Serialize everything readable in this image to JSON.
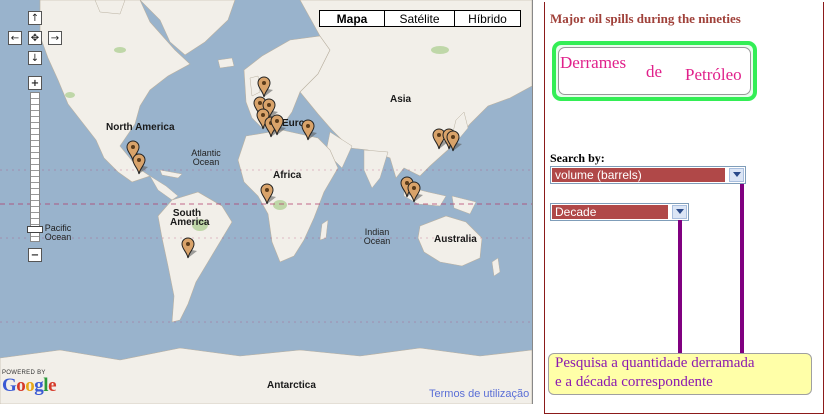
{
  "map": {
    "map_types": [
      "Mapa",
      "Satélite",
      "Híbrido"
    ],
    "active_map_type": "Mapa",
    "labels": {
      "north_america": "North America",
      "south_america": "South America",
      "atlantic": "Atlantic Ocean",
      "pacific": "Pacific Ocean",
      "indian": "Indian Ocean",
      "africa": "Africa",
      "europe": "Europ",
      "asia": "Asia",
      "australia": "Australia",
      "antarctica": "Antarctica"
    },
    "powered_by": "POWERED BY",
    "logo_letters": [
      "G",
      "o",
      "o",
      "g",
      "l",
      "e"
    ],
    "logo_colors": [
      "#3b5ad4",
      "#d63a2a",
      "#e8a81a",
      "#3b5ad4",
      "#2b9a3a",
      "#d63a2a"
    ],
    "terms_link": "Termos de utilização",
    "nav": {
      "up": "↑",
      "down": "↓",
      "left": "←",
      "right": "→",
      "center": "✥",
      "zoom_in": "+",
      "zoom_out": "−"
    },
    "marker_color": "#d9a36a"
  },
  "panel": {
    "title": "Major oil spills during the nineties",
    "logo_words": [
      "Derrames",
      "de",
      "Petróleo"
    ],
    "search_by_label": "Search by:",
    "select_volume": "volume (barrels)",
    "select_decade": "Decade",
    "note_line1": "Pesquisa a quantidade derramada",
    "note_line2": "e a década correspondente"
  }
}
